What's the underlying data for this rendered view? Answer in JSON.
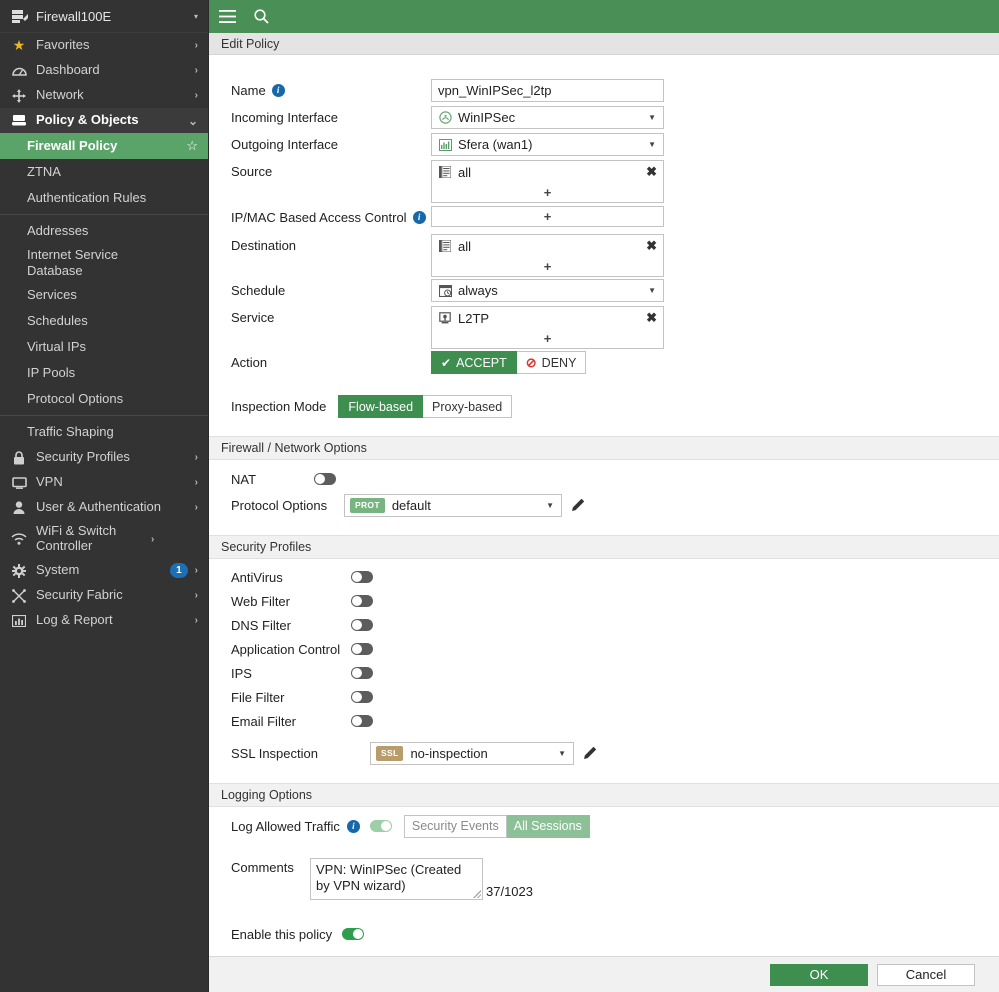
{
  "sidebar": {
    "device": {
      "name": "Firewall100E",
      "icon": "device-icon",
      "caret": "▾"
    },
    "items": [
      {
        "label": "Favorites",
        "icon": "star-icon",
        "chevron": "›",
        "type": "nav"
      },
      {
        "label": "Dashboard",
        "icon": "dashboard-icon",
        "chevron": "›",
        "type": "nav"
      },
      {
        "label": "Network",
        "icon": "network-icon",
        "chevron": "›",
        "type": "nav"
      },
      {
        "label": "Policy & Objects",
        "icon": "policy-icon",
        "chevron": "⌄",
        "type": "nav",
        "expanded": true
      }
    ],
    "sub_items": [
      {
        "label": "Firewall Policy",
        "selected": true,
        "star": "☆"
      },
      {
        "label": "ZTNA"
      },
      {
        "label": "Authentication Rules"
      },
      {
        "separator_after": true
      },
      {
        "label": "Addresses"
      },
      {
        "label": "Internet Service Database"
      },
      {
        "label": "Services"
      },
      {
        "label": "Schedules"
      },
      {
        "label": "Virtual IPs"
      },
      {
        "label": "IP Pools"
      },
      {
        "label": "Protocol Options"
      },
      {
        "separator_after": true
      },
      {
        "label": "Traffic Shaping"
      }
    ],
    "items_bottom": [
      {
        "label": "Security Profiles",
        "icon": "lock-icon",
        "chevron": "›"
      },
      {
        "label": "VPN",
        "icon": "monitor-icon",
        "chevron": "›"
      },
      {
        "label": "User & Authentication",
        "icon": "user-icon",
        "chevron": "›"
      },
      {
        "label": "WiFi & Switch Controller",
        "icon": "wifi-icon",
        "chevron": "›"
      },
      {
        "label": "System",
        "icon": "gear-icon",
        "chevron": "›",
        "badge": "1"
      },
      {
        "label": "Security Fabric",
        "icon": "fabric-icon",
        "chevron": "›"
      },
      {
        "label": "Log & Report",
        "icon": "chart-icon",
        "chevron": "›"
      }
    ]
  },
  "topbar": {
    "menu_icon": "hamburger-icon",
    "search_icon": "search-icon"
  },
  "breadcrumb": {
    "title": "Edit Policy"
  },
  "form": {
    "name": {
      "label": "Name",
      "value": "vpn_WinIPSec_l2tp",
      "info": true
    },
    "incoming_interface": {
      "label": "Incoming Interface",
      "value": "WinIPSec",
      "icon": "vpn-tunnel-icon",
      "arrow": "▼"
    },
    "outgoing_interface": {
      "label": "Outgoing Interface",
      "value": "Sfera (wan1)",
      "icon": "interface-icon",
      "arrow": "▼"
    },
    "source": {
      "label": "Source",
      "entries": [
        {
          "text": "all",
          "icon": "address-icon",
          "remove": "✖"
        }
      ],
      "add": "+"
    },
    "ipmac": {
      "label": "IP/MAC Based Access Control",
      "info": true,
      "add": "+"
    },
    "destination": {
      "label": "Destination",
      "entries": [
        {
          "text": "all",
          "icon": "address-icon",
          "remove": "✖"
        }
      ],
      "add": "+"
    },
    "schedule": {
      "label": "Schedule",
      "value": "always",
      "icon": "schedule-icon",
      "arrow": "▼"
    },
    "service": {
      "label": "Service",
      "entries": [
        {
          "text": "L2TP",
          "icon": "service-icon",
          "remove": "✖"
        }
      ],
      "add": "+"
    },
    "action": {
      "label": "Action",
      "options": [
        {
          "label": "ACCEPT",
          "icon": "check-icon",
          "active": true
        },
        {
          "label": "DENY",
          "icon": "deny-icon",
          "active": false
        }
      ]
    },
    "inspection_mode": {
      "label": "Inspection Mode",
      "options": [
        {
          "label": "Flow-based",
          "active": true
        },
        {
          "label": "Proxy-based",
          "active": false
        }
      ]
    }
  },
  "firewall_network": {
    "title": "Firewall / Network Options",
    "nat": {
      "label": "NAT",
      "on": false
    },
    "protocol_options": {
      "label": "Protocol Options",
      "badge": "PROT",
      "badge_color": "#76b57f",
      "value": "default",
      "arrow": "▼",
      "edit_icon": "pencil-icon"
    }
  },
  "security_profiles": {
    "title": "Security Profiles",
    "toggles": [
      {
        "label": "AntiVirus",
        "on": false
      },
      {
        "label": "Web Filter",
        "on": false
      },
      {
        "label": "DNS Filter",
        "on": false
      },
      {
        "label": "Application Control",
        "on": false
      },
      {
        "label": "IPS",
        "on": false
      },
      {
        "label": "File Filter",
        "on": false
      },
      {
        "label": "Email Filter",
        "on": false
      }
    ],
    "ssl_inspection": {
      "label": "SSL Inspection",
      "badge": "SSL",
      "badge_color": "#b99c6b",
      "value": "no-inspection",
      "arrow": "▼",
      "edit_icon": "pencil-icon"
    }
  },
  "logging": {
    "title": "Logging Options",
    "log_allowed_traffic": {
      "label": "Log Allowed Traffic",
      "info": true,
      "on": true,
      "options": [
        {
          "label": "Security Events",
          "active": false
        },
        {
          "label": "All Sessions",
          "active": true
        }
      ]
    },
    "comments": {
      "label": "Comments",
      "value": "VPN: WinIPSec (Created by VPN wizard)",
      "counter": "37/1023"
    },
    "enable_policy": {
      "label": "Enable this policy",
      "on": true
    }
  },
  "footer": {
    "ok": "OK",
    "cancel": "Cancel"
  },
  "colors": {
    "header_green": "#4a8f55",
    "accent_green": "#3e8e4f",
    "selected_green": "#5aa469",
    "sidebar_bg": "#333333",
    "badge_blue": "#1a6fb5"
  }
}
